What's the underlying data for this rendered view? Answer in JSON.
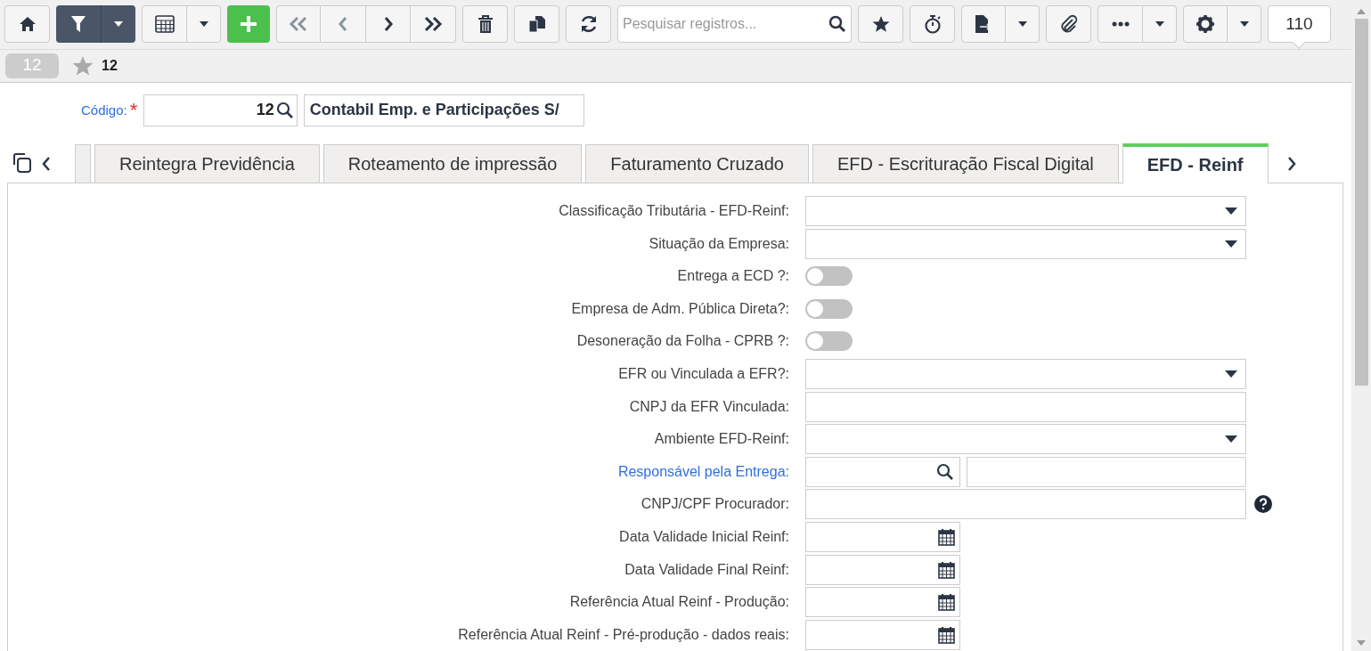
{
  "toolbar": {
    "search": {
      "placeholder": "Pesquisar registros..."
    },
    "count": "110"
  },
  "record_bar": {
    "badge": "12",
    "favorite": {
      "starred": false,
      "label": "12"
    }
  },
  "header": {
    "label": "Código:",
    "required_mark": "*",
    "code": "12",
    "name": "Contabil Emp. e Participações S/"
  },
  "tabs": [
    {
      "label": "Reintegra Previdência",
      "selected": false
    },
    {
      "label": "Roteamento de impressão",
      "selected": false
    },
    {
      "label": "Faturamento Cruzado",
      "selected": false
    },
    {
      "label": "EFD - Escrituração Fiscal Digital",
      "selected": false
    },
    {
      "label": "EFD - Reinf",
      "selected": true
    }
  ],
  "fields": [
    {
      "label": "Classificação Tributária - EFD-Reinf:",
      "kind": "select"
    },
    {
      "label": "Situação da Empresa:",
      "kind": "select"
    },
    {
      "label": "Entrega a ECD ?:",
      "kind": "toggle",
      "on": false
    },
    {
      "label": "Empresa de Adm. Pública Direta?:",
      "kind": "toggle",
      "on": false
    },
    {
      "label": "Desoneração da Folha - CPRB ?:",
      "kind": "toggle",
      "on": false
    },
    {
      "label": "EFR ou Vinculada a EFR?:",
      "kind": "select"
    },
    {
      "label": "CNPJ da EFR Vinculada:",
      "kind": "text"
    },
    {
      "label": "Ambiente EFD-Reinf:",
      "kind": "select"
    },
    {
      "label": "Responsável pela Entrega:",
      "kind": "lookup",
      "link": true
    },
    {
      "label": "CNPJ/CPF Procurador:",
      "kind": "help"
    },
    {
      "label": "Data Validade Inicial Reinf:",
      "kind": "date"
    },
    {
      "label": "Data Validade Final Reinf:",
      "kind": "date"
    },
    {
      "label": "Referência Atual Reinf - Produção:",
      "kind": "date"
    },
    {
      "label": "Referência Atual Reinf - Pré-produção - dados reais:",
      "kind": "date"
    }
  ]
}
